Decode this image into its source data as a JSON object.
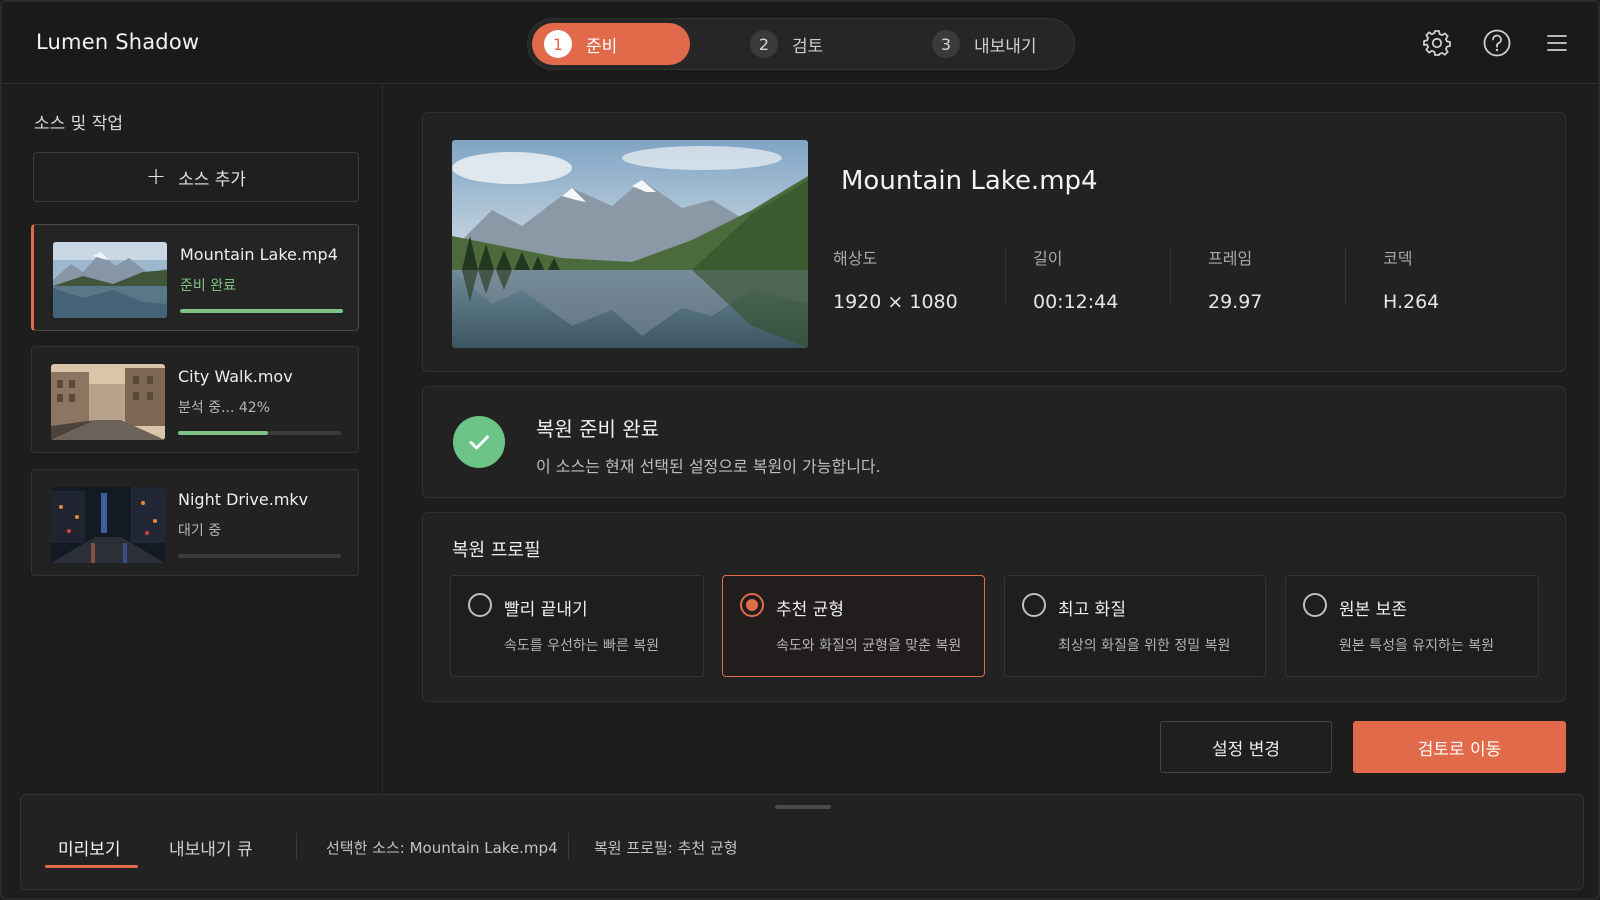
{
  "app": {
    "title": "Lumen Shadow"
  },
  "steps": [
    {
      "num": "1",
      "label": "준비",
      "active": true
    },
    {
      "num": "2",
      "label": "검토",
      "active": false
    },
    {
      "num": "3",
      "label": "내보내기",
      "active": false
    }
  ],
  "header_icons": [
    "gear-icon",
    "help-icon",
    "menu-icon"
  ],
  "sidebar": {
    "title": "소스 및 작업",
    "add_label": "소스 추가",
    "sources": [
      {
        "name": "Mountain Lake.mp4",
        "status": "준비 완료",
        "progress": 1.0
      },
      {
        "name": "City Walk.mov",
        "status": "분석 중... 42%",
        "progress": 0.42
      },
      {
        "name": "Night Drive.mkv",
        "status": "대기 중",
        "progress": 0.0
      }
    ]
  },
  "file_info": {
    "name": "Mountain Lake.mp4",
    "meta": [
      {
        "label": "해상도",
        "value": "1920 × 1080"
      },
      {
        "label": "길이",
        "value": "00:12:44"
      },
      {
        "label": "프레임",
        "value": "29.97"
      },
      {
        "label": "코덱",
        "value": "H.264"
      }
    ]
  },
  "status": {
    "title": "복원 준비 완료",
    "description": "이 소스는 현재 선택된 설정으로 복원이 가능합니다."
  },
  "profile": {
    "title": "복원 프로필",
    "options": [
      {
        "title": "빨리 끝내기",
        "desc": "속도를 우선하는 빠른 복원",
        "selected": false
      },
      {
        "title": "추천 균형",
        "desc": "속도와 화질의 균형을 맞춘 복원",
        "selected": true
      },
      {
        "title": "최고 화질",
        "desc": "최상의 화질을 위한 정밀 복원",
        "selected": false
      },
      {
        "title": "원본 보존",
        "desc": "원본 특성을 유지하는 복원",
        "selected": false
      }
    ]
  },
  "actions": {
    "secondary": "설정 변경",
    "primary": "검토로 이동"
  },
  "bottom_bar": {
    "tabs": [
      "미리보기",
      "내보내기 큐"
    ],
    "selected_source": "선택한 소스: Mountain Lake.mp4",
    "selected_profile": "복원 프로필: 추천 균형"
  },
  "colors": {
    "accent": "#e06a4a",
    "success": "#6cc487",
    "background": "#1d1d1d"
  }
}
